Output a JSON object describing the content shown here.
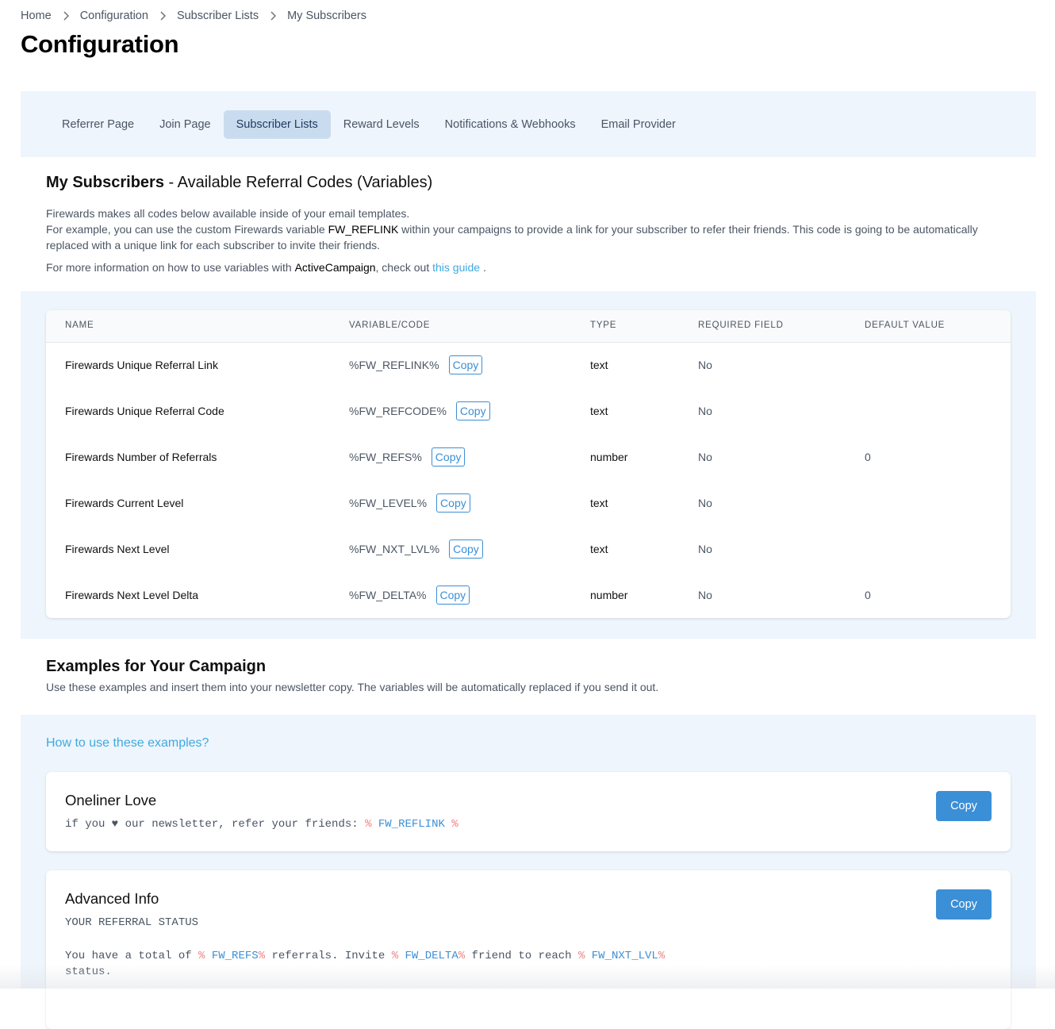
{
  "breadcrumb": [
    "Home",
    "Configuration",
    "Subscriber Lists",
    "My Subscribers"
  ],
  "page_title": "Configuration",
  "tabs": [
    {
      "label": "Referrer Page",
      "active": false
    },
    {
      "label": "Join Page",
      "active": false
    },
    {
      "label": "Subscriber Lists",
      "active": true
    },
    {
      "label": "Reward Levels",
      "active": false
    },
    {
      "label": "Notifications & Webhooks",
      "active": false
    },
    {
      "label": "Email Provider",
      "active": false
    }
  ],
  "section": {
    "title_bold": "My Subscribers",
    "title_rest": " - Available Referral Codes (Variables)",
    "line1": "Firewards makes all codes below available inside of your email templates.",
    "line2_pre": "For example, you can use the custom Firewards variable ",
    "line2_code": "FW_REFLINK",
    "line2_post": " within your campaigns to provide a link for your subscriber to refer their friends. This code is going to be automatically replaced with a unique link for each subscriber to invite their friends.",
    "more_pre": "For more information on how to use variables with ",
    "more_provider": "ActiveCampaign",
    "more_mid": ", check out ",
    "more_link": "this guide",
    "more_post": " ."
  },
  "table": {
    "headers": [
      "Name",
      "Variable/Code",
      "Type",
      "Required Field",
      "Default Value"
    ],
    "copy_label": "Copy",
    "rows": [
      {
        "name": "Firewards Unique Referral Link",
        "code": "%FW_REFLINK%",
        "type": "text",
        "required": "No",
        "default": ""
      },
      {
        "name": "Firewards Unique Referral Code",
        "code": "%FW_REFCODE%",
        "type": "text",
        "required": "No",
        "default": ""
      },
      {
        "name": "Firewards Number of Referrals",
        "code": "%FW_REFS%",
        "type": "number",
        "required": "No",
        "default": "0"
      },
      {
        "name": "Firewards Current Level",
        "code": "%FW_LEVEL%",
        "type": "text",
        "required": "No",
        "default": ""
      },
      {
        "name": "Firewards Next Level",
        "code": "%FW_NXT_LVL%",
        "type": "text",
        "required": "No",
        "default": ""
      },
      {
        "name": "Firewards Next Level Delta",
        "code": "%FW_DELTA%",
        "type": "number",
        "required": "No",
        "default": "0"
      }
    ]
  },
  "examples": {
    "title": "Examples for Your Campaign",
    "desc": "Use these examples and insert them into your newsletter copy. The variables will be automatically replaced if you send it out.",
    "how_link": "How to use these examples?",
    "copy_label": "Copy",
    "oneliner": {
      "name": "Oneliner Love",
      "text": "if you ♥ our newsletter, refer your friends: ",
      "pct": "%",
      "var": "FW_REFLINK"
    },
    "advanced": {
      "name": "Advanced Info",
      "heading": "YOUR REFERRAL STATUS",
      "t1": "You have a total of ",
      "v1": "FW_REFS",
      "t2": " referrals. Invite ",
      "v2": "FW_DELTA",
      "t3": " friend to reach ",
      "v3": "FW_NXT_LVL",
      "t4": "status.",
      "pct": "%"
    }
  }
}
